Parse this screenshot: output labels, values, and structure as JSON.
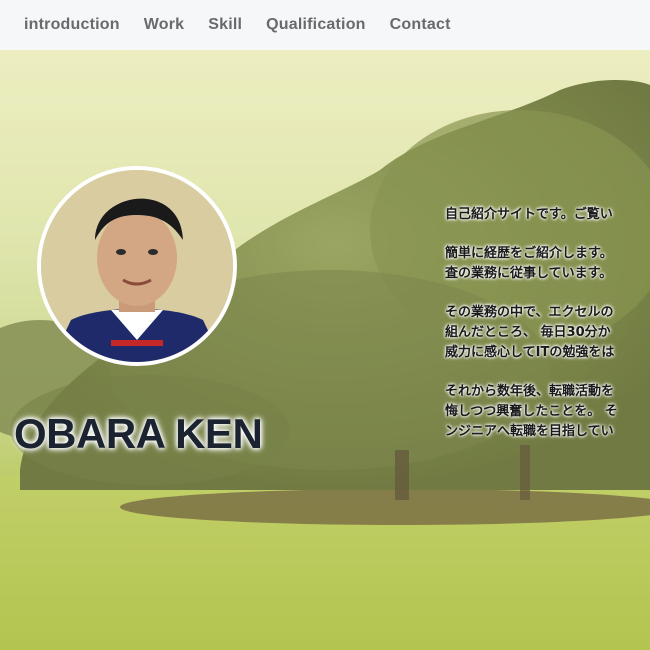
{
  "nav": {
    "items": [
      "introduction",
      "Work",
      "Skill",
      "Qualification",
      "Contact"
    ]
  },
  "profile": {
    "name": "OBARA KEN",
    "bio": [
      [
        "自己紹介サイトです。ご覧い"
      ],
      [
        "簡単に経歴をご紹介します。",
        "査の業務に従事しています。"
      ],
      [
        "その業務の中で、エクセルの",
        "組んだところ、 毎日30分か",
        "威力に感心してITの勉強をは"
      ],
      [
        "それから数年後、転職活動を",
        "悔しつつ興奮したことを。 そ",
        "ンジニアへ転職を目指してい"
      ]
    ]
  },
  "colors": {
    "nav_background": "#f6f7f9",
    "nav_text": "#6a6a6a",
    "name_text": "#1b2330"
  }
}
